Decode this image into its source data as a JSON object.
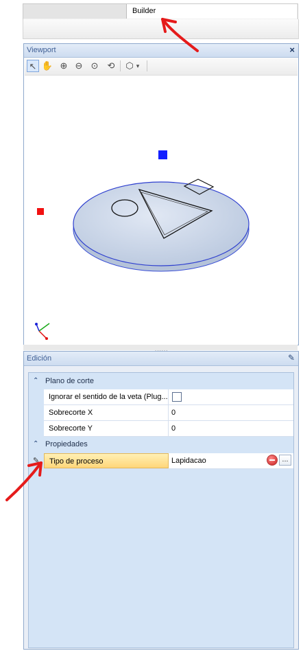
{
  "document_tabs": {
    "inactive": "",
    "active": "Builder"
  },
  "viewport": {
    "title": "Viewport",
    "close_glyph": "×",
    "toolbar": [
      {
        "name": "select-tool-icon",
        "glyph": "↖"
      },
      {
        "name": "pan-tool-icon",
        "glyph": "✋"
      },
      {
        "name": "zoom-window-icon",
        "glyph": "⊕"
      },
      {
        "name": "zoom-out-icon",
        "glyph": "⊖"
      },
      {
        "name": "zoom-extents-icon",
        "glyph": "⊙"
      },
      {
        "name": "orbit-icon",
        "glyph": "⟲"
      },
      {
        "name": "view-cube-icon",
        "glyph": "⬡"
      }
    ],
    "view_dropdown_glyph": "▾"
  },
  "splitter_grip": "......",
  "edition": {
    "title": "Edición",
    "pin_glyph": "✎",
    "categories": [
      {
        "label": "Plano de corte",
        "rows": [
          {
            "name": "Ignorar el sentido de la veta (Plug...",
            "value": "",
            "type": "checkbox"
          },
          {
            "name": "Sobrecorte X",
            "value": "0"
          },
          {
            "name": "Sobrecorte Y",
            "value": "0"
          }
        ]
      },
      {
        "label": "Propiedades",
        "rows": [
          {
            "name": "Tipo de proceso",
            "value": "Lapidacao",
            "selected": true
          }
        ]
      }
    ],
    "more_button": "..."
  },
  "colors": {
    "accent": "#3f5f95",
    "annotation_arrow": "#e51b1b",
    "selection": "#ffd67a",
    "panel_bg": "#d4e4f6"
  }
}
